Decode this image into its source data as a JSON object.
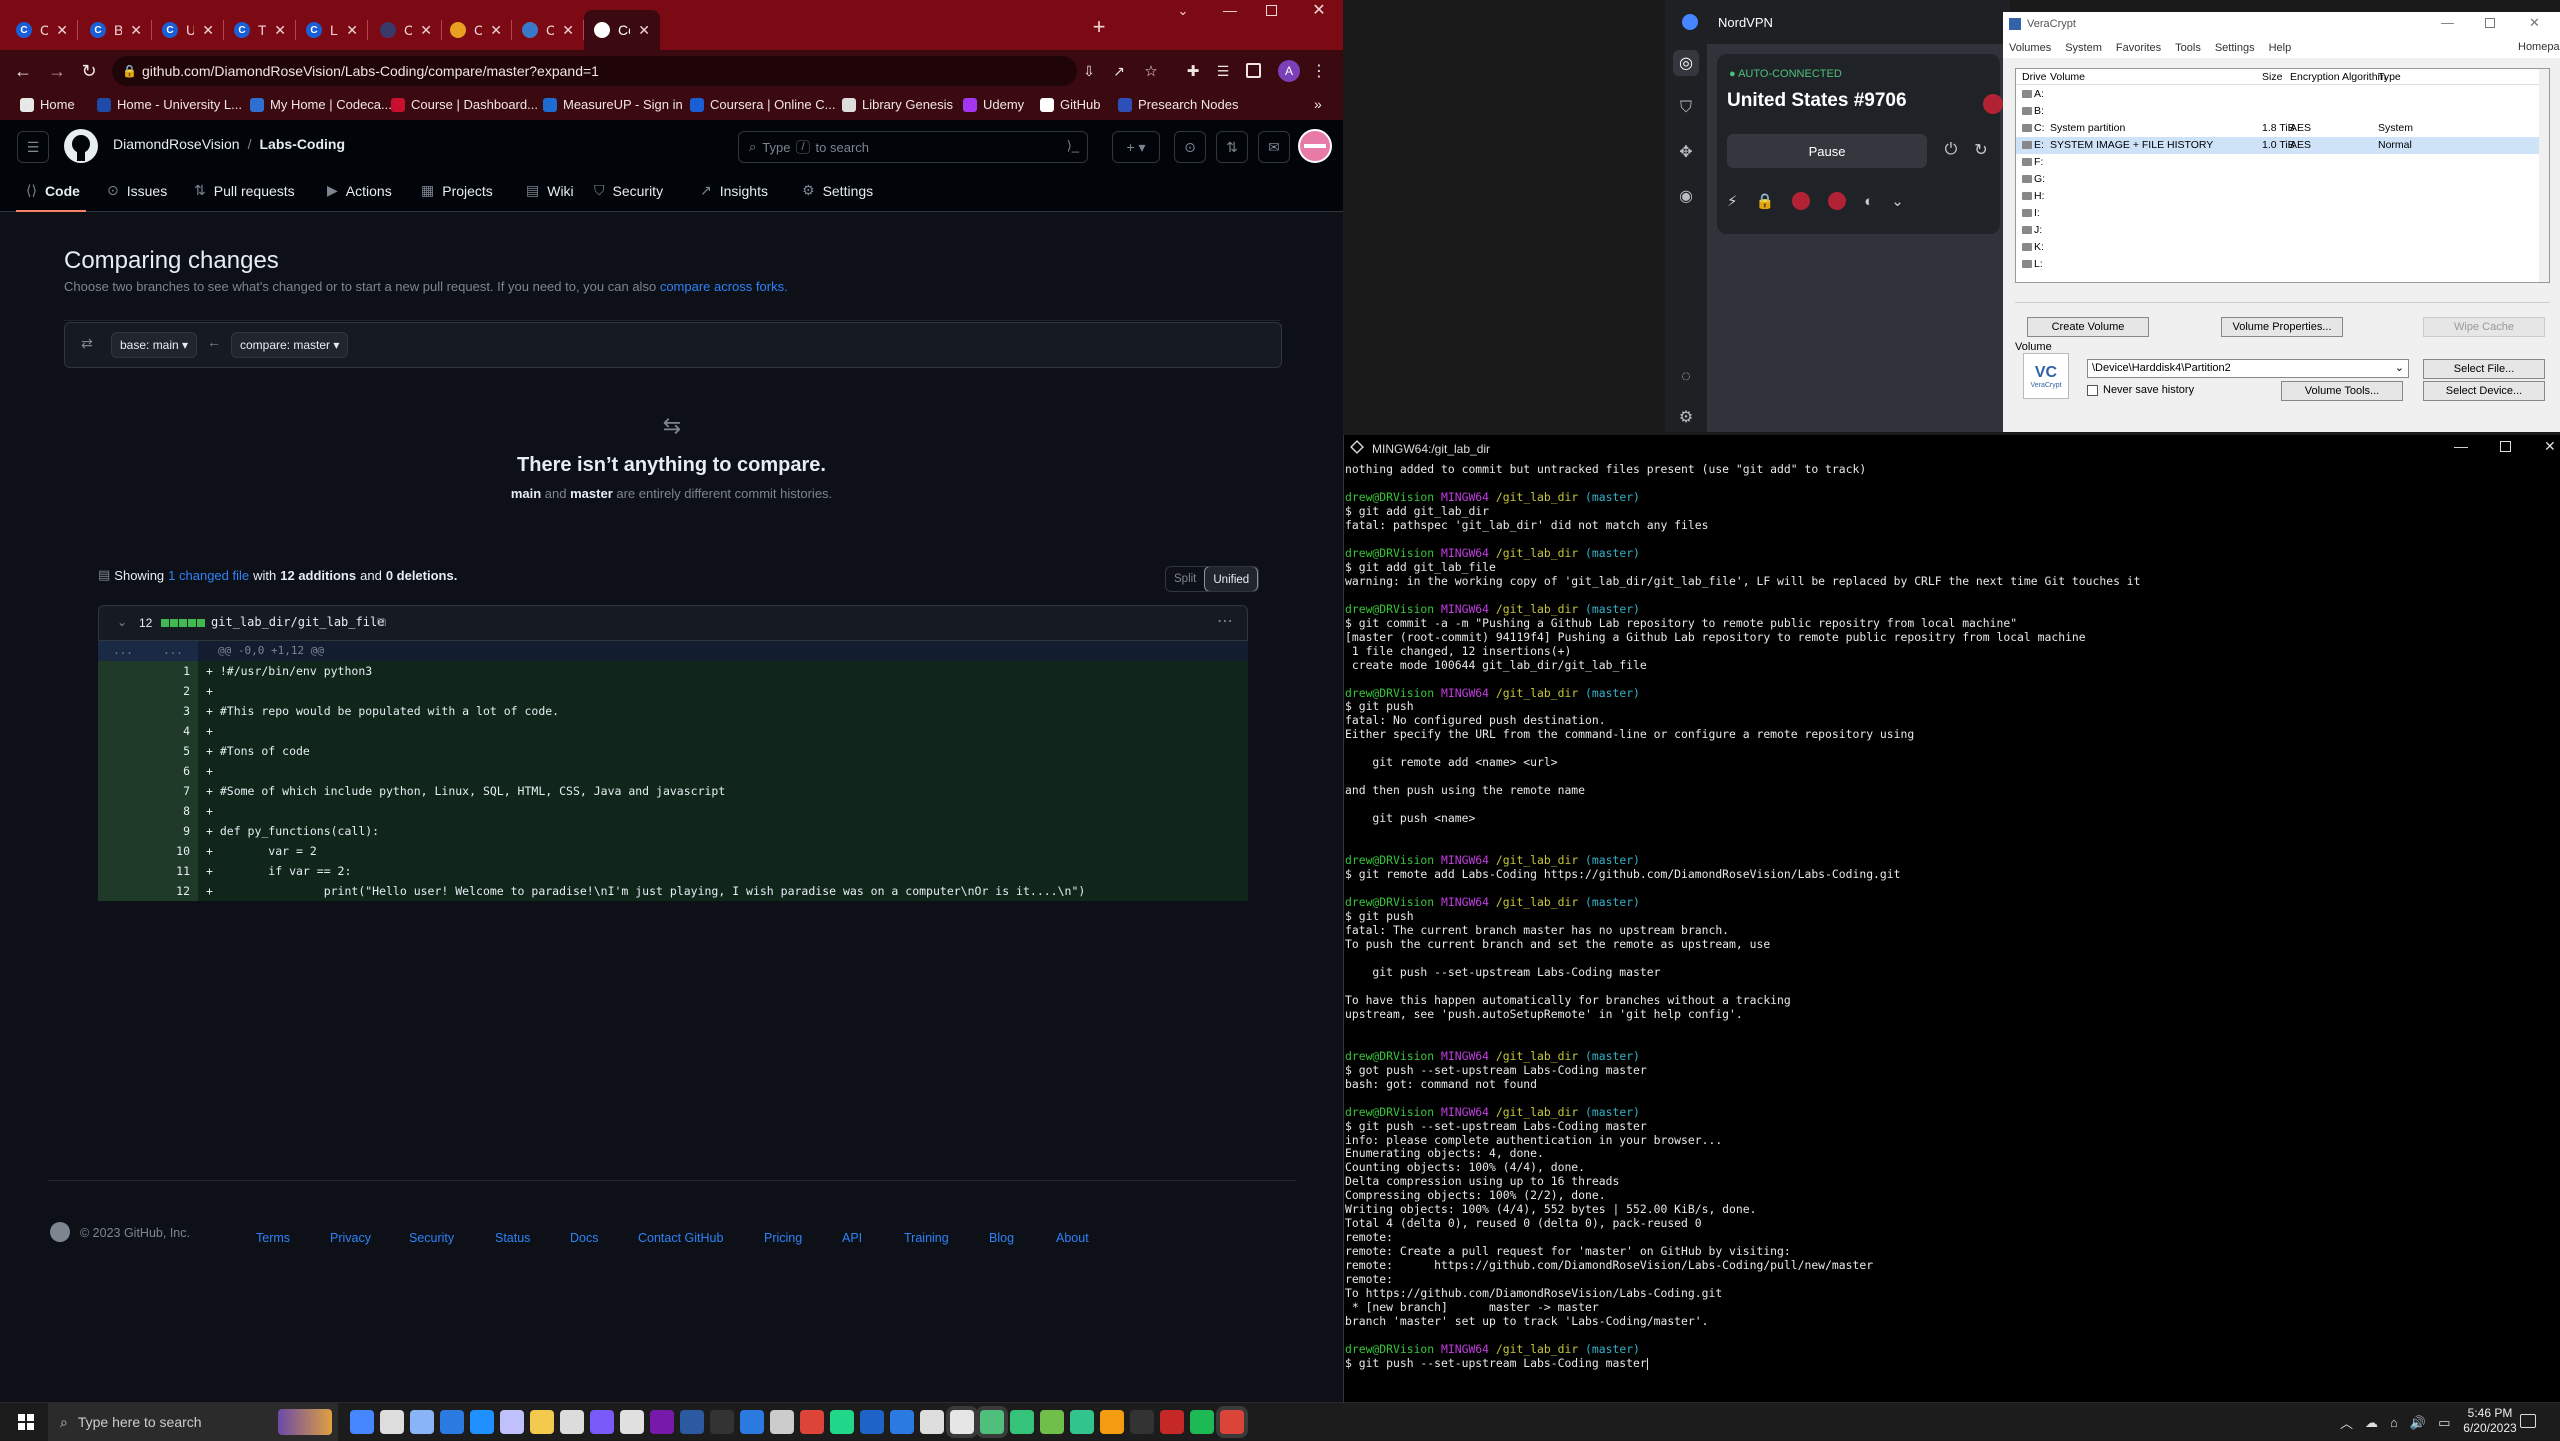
{
  "chrome": {
    "tabs": [
      {
        "label": "Coursera |",
        "fav": "C",
        "color": "#1a5fd6"
      },
      {
        "label": "Basic Inte",
        "fav": "C",
        "color": "#1a5fd6"
      },
      {
        "label": "Using Pyt",
        "fav": "C",
        "color": "#1a5fd6"
      },
      {
        "label": "Timechart",
        "fav": "C",
        "color": "#1a5fd6"
      },
      {
        "label": "Linux Basi",
        "fav": "C",
        "color": "#1a5fd6"
      },
      {
        "label": "Computer",
        "fav": "",
        "color": "#3a3a6a"
      },
      {
        "label": "Content /",
        "fav": "",
        "color": "#e8a020"
      },
      {
        "label": "Cisco.com",
        "fav": "",
        "color": "#3a78c8"
      },
      {
        "label": "Comparin",
        "fav": "",
        "color": "#ffffff"
      }
    ],
    "url": "github.com/DiamondRoseVision/Labs-Coding/compare/master?expand=1",
    "bookmarks": [
      {
        "label": "Home",
        "color": "#e8e8e8"
      },
      {
        "label": "Home - University L...",
        "color": "#1e4aa8"
      },
      {
        "label": "My Home | Codeca...",
        "color": "#2f6fd1"
      },
      {
        "label": "Course | Dashboard...",
        "color": "#c8102e"
      },
      {
        "label": "MeasureUP - Sign in",
        "color": "#1e6bd1"
      },
      {
        "label": "Coursera | Online C...",
        "color": "#1a5fd6"
      },
      {
        "label": "Library Genesis",
        "color": "#dddddd"
      },
      {
        "label": "Udemy",
        "color": "#a435f0"
      },
      {
        "label": "GitHub",
        "color": "#ffffff"
      },
      {
        "label": "Presearch Nodes",
        "color": "#2f4fb8"
      }
    ],
    "more": "»"
  },
  "github": {
    "owner": "DiamondRoseVision",
    "sep": "/",
    "repo": "Labs-Coding",
    "search_placeholder_a": "Type",
    "search_key": "/",
    "search_placeholder_b": "to search",
    "nav": [
      "Code",
      "Issues",
      "Pull requests",
      "Actions",
      "Projects",
      "Wiki",
      "Security",
      "Insights",
      "Settings"
    ],
    "title": "Comparing changes",
    "subtitle": "Choose two branches to see what's changed or to start a new pull request. If you need to, you can also",
    "subtitle_link": "compare across forks.",
    "base": "base: main",
    "compare": "compare: master",
    "empty_title": "There isn’t anything to compare.",
    "empty_b1": "main",
    "empty_mid": "and",
    "empty_b2": "master",
    "empty_tail": "are entirely different commit histories.",
    "showing": "Showing",
    "changed_file": "1 changed file",
    "with": "with",
    "additions": "12 additions",
    "and": "and",
    "deletions": "0 deletions.",
    "split": "Split",
    "unified": "Unified",
    "file_count": "12",
    "file_name": "git_lab_dir/git_lab_file",
    "hunk_dots": "...",
    "hunk": "@@ -0,0 +1,12 @@",
    "lines": [
      "+ !#/usr/bin/env python3",
      "+",
      "+ #This repo would be populated with a lot of code.",
      "+",
      "+ #Tons of code",
      "+",
      "+ #Some of which include python, Linux, SQL, HTML, CSS, Java and javascript",
      "+",
      "+ def py_functions(call):",
      "+        var = 2",
      "+        if var == 2:",
      "+                print(\"Hello user! Welcome to paradise!\\nI'm just playing, I wish paradise was on a computer\\nOr is it....\\n\")"
    ],
    "copyright": "© 2023 GitHub, Inc.",
    "footer": [
      "Terms",
      "Privacy",
      "Security",
      "Status",
      "Docs",
      "Contact GitHub",
      "Pricing",
      "API",
      "Training",
      "Blog",
      "About"
    ]
  },
  "nord": {
    "app": "NordVPN",
    "status": "AUTO-CONNECTED",
    "server": "United States #9706",
    "pause": "Pause"
  },
  "vera": {
    "title": "VeraCrypt",
    "menu": [
      "Volumes",
      "System",
      "Favorites",
      "Tools",
      "Settings",
      "Help"
    ],
    "homepage": "Homepage",
    "cols": [
      "Drive",
      "Volume",
      "Size",
      "Encryption Algorithm",
      "Type"
    ],
    "drives": [
      {
        "d": "A:",
        "v": "",
        "s": "",
        "e": "",
        "t": ""
      },
      {
        "d": "B:",
        "v": "",
        "s": "",
        "e": "",
        "t": ""
      },
      {
        "d": "C:",
        "v": "System partition",
        "s": "1.8 TiB",
        "e": "AES",
        "t": "System"
      },
      {
        "d": "E:",
        "v": "SYSTEM IMAGE + FILE HISTORY",
        "s": "1.0 TiB",
        "e": "AES",
        "t": "Normal"
      },
      {
        "d": "F:",
        "v": "",
        "s": "",
        "e": "",
        "t": ""
      },
      {
        "d": "G:",
        "v": "",
        "s": "",
        "e": "",
        "t": ""
      },
      {
        "d": "H:",
        "v": "",
        "s": "",
        "e": "",
        "t": ""
      },
      {
        "d": "I:",
        "v": "",
        "s": "",
        "e": "",
        "t": ""
      },
      {
        "d": "J:",
        "v": "",
        "s": "",
        "e": "",
        "t": ""
      },
      {
        "d": "K:",
        "v": "",
        "s": "",
        "e": "",
        "t": ""
      },
      {
        "d": "L:",
        "v": "",
        "s": "",
        "e": "",
        "t": ""
      }
    ],
    "create": "Create Volume",
    "props": "Volume Properties...",
    "wipe": "Wipe Cache",
    "volume_label": "Volume",
    "volume_path": "\\Device\\Harddisk4\\Partition2",
    "select_file": "Select File...",
    "never_save": "Never save history",
    "volume_tools": "Volume Tools...",
    "select_device": "Select Device...",
    "logo": "VeraCrypt"
  },
  "terminal": {
    "title": "MINGW64:/git_lab_dir",
    "prompt": {
      "user": "drew@DRVision",
      "host": "MINGW64",
      "dir": "/git_lab_dir",
      "branch": "(master)"
    },
    "lines": [
      {
        "t": "o",
        "s": "nothing added to commit but untracked files present (use \"git add\" to track)"
      },
      {
        "t": "o",
        "s": ""
      },
      {
        "t": "p"
      },
      {
        "t": "o",
        "s": "$ git add git_lab_dir"
      },
      {
        "t": "o",
        "s": "fatal: pathspec 'git_lab_dir' did not match any files"
      },
      {
        "t": "o",
        "s": ""
      },
      {
        "t": "p"
      },
      {
        "t": "o",
        "s": "$ git add git_lab_file"
      },
      {
        "t": "o",
        "s": "warning: in the working copy of 'git_lab_dir/git_lab_file', LF will be replaced by CRLF the next time Git touches it"
      },
      {
        "t": "o",
        "s": ""
      },
      {
        "t": "p"
      },
      {
        "t": "o",
        "s": "$ git commit -a -m \"Pushing a Github Lab repository to remote public repositry from local machine\""
      },
      {
        "t": "o",
        "s": "[master (root-commit) 94119f4] Pushing a Github Lab repository to remote public repositry from local machine"
      },
      {
        "t": "o",
        "s": " 1 file changed, 12 insertions(+)"
      },
      {
        "t": "o",
        "s": " create mode 100644 git_lab_dir/git_lab_file"
      },
      {
        "t": "o",
        "s": ""
      },
      {
        "t": "p"
      },
      {
        "t": "o",
        "s": "$ git push"
      },
      {
        "t": "o",
        "s": "fatal: No configured push destination."
      },
      {
        "t": "o",
        "s": "Either specify the URL from the command-line or configure a remote repository using"
      },
      {
        "t": "o",
        "s": ""
      },
      {
        "t": "o",
        "s": "    git remote add <name> <url>"
      },
      {
        "t": "o",
        "s": ""
      },
      {
        "t": "o",
        "s": "and then push using the remote name"
      },
      {
        "t": "o",
        "s": ""
      },
      {
        "t": "o",
        "s": "    git push <name>"
      },
      {
        "t": "o",
        "s": ""
      },
      {
        "t": "o",
        "s": ""
      },
      {
        "t": "p"
      },
      {
        "t": "o",
        "s": "$ git remote add Labs-Coding https://github.com/DiamondRoseVision/Labs-Coding.git"
      },
      {
        "t": "o",
        "s": ""
      },
      {
        "t": "p"
      },
      {
        "t": "o",
        "s": "$ git push"
      },
      {
        "t": "o",
        "s": "fatal: The current branch master has no upstream branch."
      },
      {
        "t": "o",
        "s": "To push the current branch and set the remote as upstream, use"
      },
      {
        "t": "o",
        "s": ""
      },
      {
        "t": "o",
        "s": "    git push --set-upstream Labs-Coding master"
      },
      {
        "t": "o",
        "s": ""
      },
      {
        "t": "o",
        "s": "To have this happen automatically for branches without a tracking"
      },
      {
        "t": "o",
        "s": "upstream, see 'push.autoSetupRemote' in 'git help config'."
      },
      {
        "t": "o",
        "s": ""
      },
      {
        "t": "o",
        "s": ""
      },
      {
        "t": "p"
      },
      {
        "t": "o",
        "s": "$ got push --set-upstream Labs-Coding master"
      },
      {
        "t": "o",
        "s": "bash: got: command not found"
      },
      {
        "t": "o",
        "s": ""
      },
      {
        "t": "p"
      },
      {
        "t": "o",
        "s": "$ git push --set-upstream Labs-Coding master"
      },
      {
        "t": "o",
        "s": "info: please complete authentication in your browser..."
      },
      {
        "t": "o",
        "s": "Enumerating objects: 4, done."
      },
      {
        "t": "o",
        "s": "Counting objects: 100% (4/4), done."
      },
      {
        "t": "o",
        "s": "Delta compression using up to 16 threads"
      },
      {
        "t": "o",
        "s": "Compressing objects: 100% (2/2), done."
      },
      {
        "t": "o",
        "s": "Writing objects: 100% (4/4), 552 bytes | 552.00 KiB/s, done."
      },
      {
        "t": "o",
        "s": "Total 4 (delta 0), reused 0 (delta 0), pack-reused 0"
      },
      {
        "t": "o",
        "s": "remote:"
      },
      {
        "t": "o",
        "s": "remote: Create a pull request for 'master' on GitHub by visiting:"
      },
      {
        "t": "o",
        "s": "remote:      https://github.com/DiamondRoseVision/Labs-Coding/pull/new/master"
      },
      {
        "t": "o",
        "s": "remote:"
      },
      {
        "t": "o",
        "s": "To https://github.com/DiamondRoseVision/Labs-Coding.git"
      },
      {
        "t": "o",
        "s": " * [new branch]      master -> master"
      },
      {
        "t": "o",
        "s": "branch 'master' set up to track 'Labs-Coding/master'."
      },
      {
        "t": "o",
        "s": ""
      },
      {
        "t": "p"
      },
      {
        "t": "o",
        "s": "$ git push --set-upstream Labs-Coding master"
      }
    ]
  },
  "taskbar": {
    "search": "Type here to search",
    "time": "5:46 PM",
    "date": "6/20/2023"
  }
}
